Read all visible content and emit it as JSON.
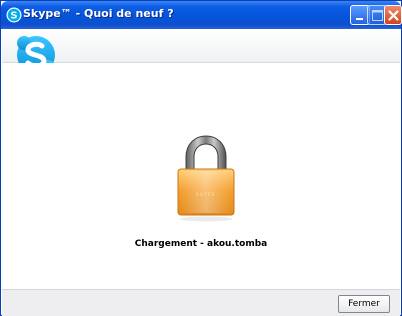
{
  "window": {
    "title": "Skype™ - Quoi de neuf ?",
    "titlebar_color": "#0455d9"
  },
  "buttons": {
    "minimize_icon": "minimize-icon",
    "maximize_icon": "maximize-icon",
    "close_icon": "close-icon",
    "fermer_label": "Fermer"
  },
  "content": {
    "logo": "skype-logo",
    "lock_icon": "padlock-icon",
    "lock_engraving": "SKYPE",
    "status_text": "Chargement - akou.tomba"
  },
  "colors": {
    "brand_blue": "#00aff0",
    "lock_orange": "#f5a031"
  }
}
